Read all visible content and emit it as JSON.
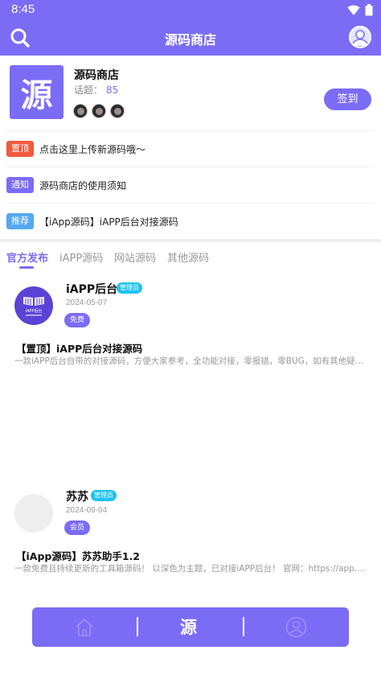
{
  "status_bar": {
    "time": "8:45"
  },
  "app_bar": {
    "title": "源码商店"
  },
  "store": {
    "logo_char": "源",
    "name": "源码商店",
    "topics_label": "话题：",
    "topics_count": "85",
    "checkin_label": "签到",
    "member_count": 3
  },
  "notices": [
    {
      "tag": "置顶",
      "text": "点击这里上传新源码哦～",
      "color": "#f25a3c"
    },
    {
      "tag": "通知",
      "text": "源码商店的使用须知",
      "color": "#7b6cf6"
    },
    {
      "tag": "推荐",
      "text": "【iApp源码】iAPP后台对接源码",
      "color": "#54a9f0"
    }
  ],
  "tabs": [
    {
      "label": "官方发布",
      "active": true
    },
    {
      "label": "iAPP源码",
      "active": false
    },
    {
      "label": "网站源码",
      "active": false
    },
    {
      "label": "其他源码",
      "active": false
    }
  ],
  "posts": [
    {
      "author": "iAPP后台",
      "role": "管理员",
      "date": "2024-05-07",
      "chip": "免费",
      "avatar_text": "iAPP后台",
      "title": "【置顶】iAPP后台对接源码",
      "desc": "一款iAPP后台自带的对接源码，方便大家参考，全功能对接，零报错，零BUG，如有其他疑问请联系管理员"
    },
    {
      "author": "苏苏",
      "role": "管理员",
      "date": "2024-09-04",
      "chip": "会员",
      "title": "【iApp源码】苏苏助手1.2",
      "desc": "一款免费且持续更新的工具箱源码！ 以深色为主题，已对接iAPP后台！ 官网：https://app.isusu.cn"
    }
  ],
  "bottom_nav": {
    "center_char": "源"
  },
  "colors": {
    "primary": "#7b6cf6",
    "badge": "#20c2f0"
  },
  "icons": [
    "search-icon",
    "avatar-icon",
    "wifi-icon",
    "battery-icon",
    "home-icon",
    "user-icon"
  ]
}
